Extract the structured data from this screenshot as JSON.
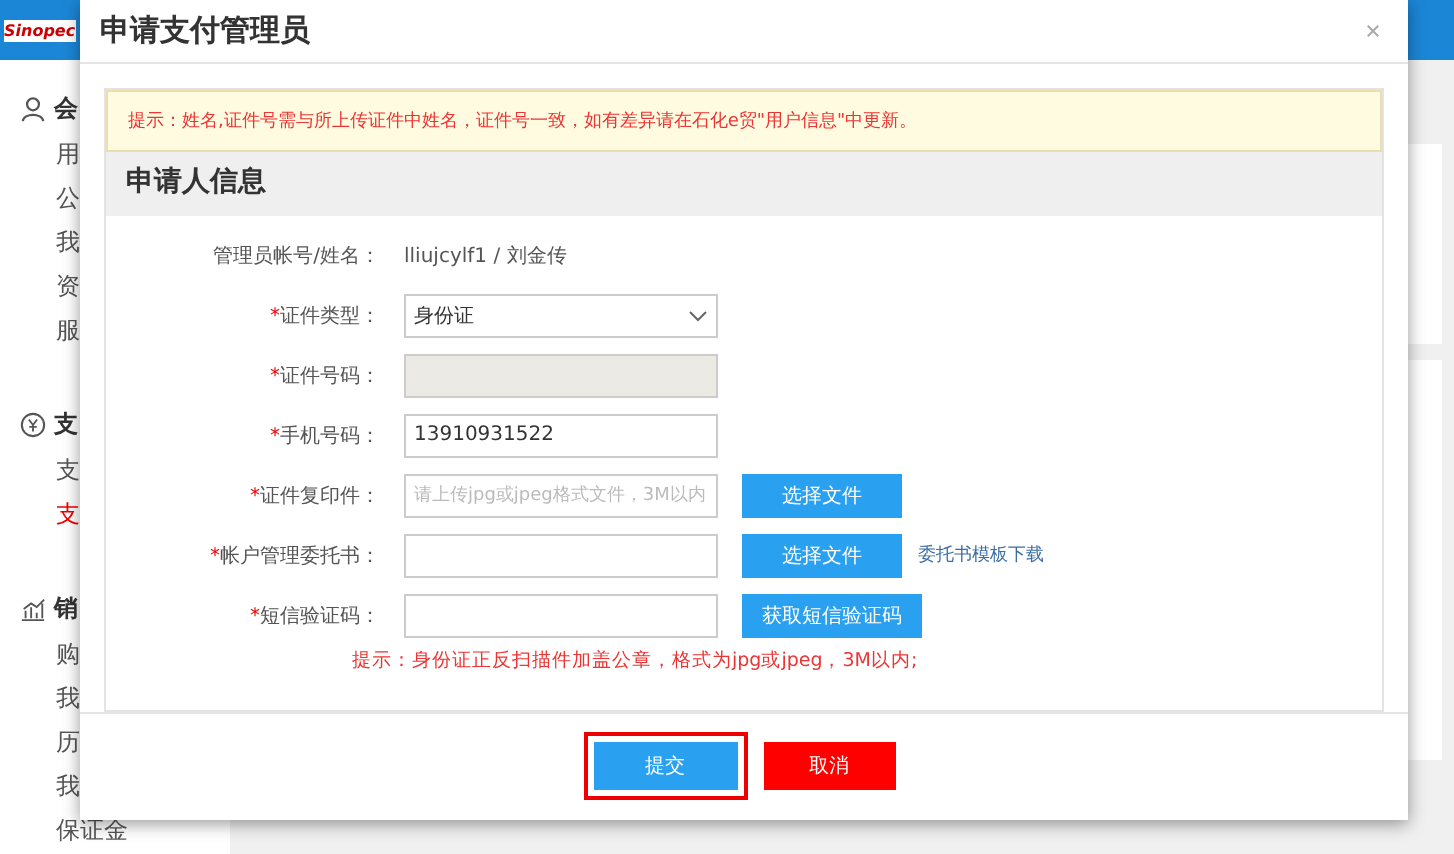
{
  "background": {
    "logo": "Sinopec",
    "sidebar": [
      {
        "label": "会",
        "kind": "section",
        "selected": false
      },
      {
        "label": "用",
        "kind": "item",
        "selected": false
      },
      {
        "label": "公",
        "kind": "item",
        "selected": false
      },
      {
        "label": "我",
        "kind": "item",
        "selected": false
      },
      {
        "label": "资",
        "kind": "item",
        "selected": false
      },
      {
        "label": "服",
        "kind": "item",
        "selected": false
      },
      {
        "label": "支",
        "kind": "section",
        "selected": false
      },
      {
        "label": "支",
        "kind": "item",
        "selected": false
      },
      {
        "label": "支",
        "kind": "item",
        "selected": true
      },
      {
        "label": "销",
        "kind": "section",
        "selected": false
      },
      {
        "label": "购",
        "kind": "item",
        "selected": false
      },
      {
        "label": "我",
        "kind": "item",
        "selected": false
      },
      {
        "label": "历",
        "kind": "item",
        "selected": false
      },
      {
        "label": "我",
        "kind": "item",
        "selected": false
      },
      {
        "label": "保证金",
        "kind": "item",
        "selected": false
      }
    ]
  },
  "dialog": {
    "title": "申请支付管理员",
    "notice": "提示：姓名,证件号需与所上传证件中姓名，证件号一致，如有差异请在石化e贸\"用户信息\"中更新。",
    "section_title": "申请人信息",
    "fields": [
      {
        "label": "管理员帐号/姓名：",
        "kind": "text",
        "value": "lliujcylf1 / 刘金传"
      },
      {
        "label": "证件类型：",
        "mark": "*",
        "kind": "select",
        "value": "身份证"
      },
      {
        "label": "证件号码：",
        "mark": "*",
        "kind": "input",
        "disabled": true
      },
      {
        "label": "手机号码：",
        "mark": "*",
        "kind": "input",
        "disabled": false,
        "value": "13910931522"
      },
      {
        "label": "证件复印件：",
        "mark": "*",
        "kind": "input",
        "disabled": false,
        "placeholder": "请上传jpg或jpeg格式文件，3M以内",
        "button": "选择文件"
      },
      {
        "label": "帐户管理委托书：",
        "mark": "*",
        "kind": "input",
        "disabled": false,
        "button": "选择文件",
        "link": "委托书模板下载"
      },
      {
        "label": "短信验证码：",
        "mark": "*",
        "kind": "input",
        "disabled": false,
        "button": "获取短信验证码"
      }
    ],
    "hint": "提示：身份证正反扫描件加盖公章，格式为jpg或jpeg，3M以内;",
    "buttons": [
      {
        "label": "提交",
        "kind": "primary",
        "highlighted": true
      },
      {
        "label": "取消",
        "kind": "danger",
        "highlighted": false
      }
    ]
  }
}
